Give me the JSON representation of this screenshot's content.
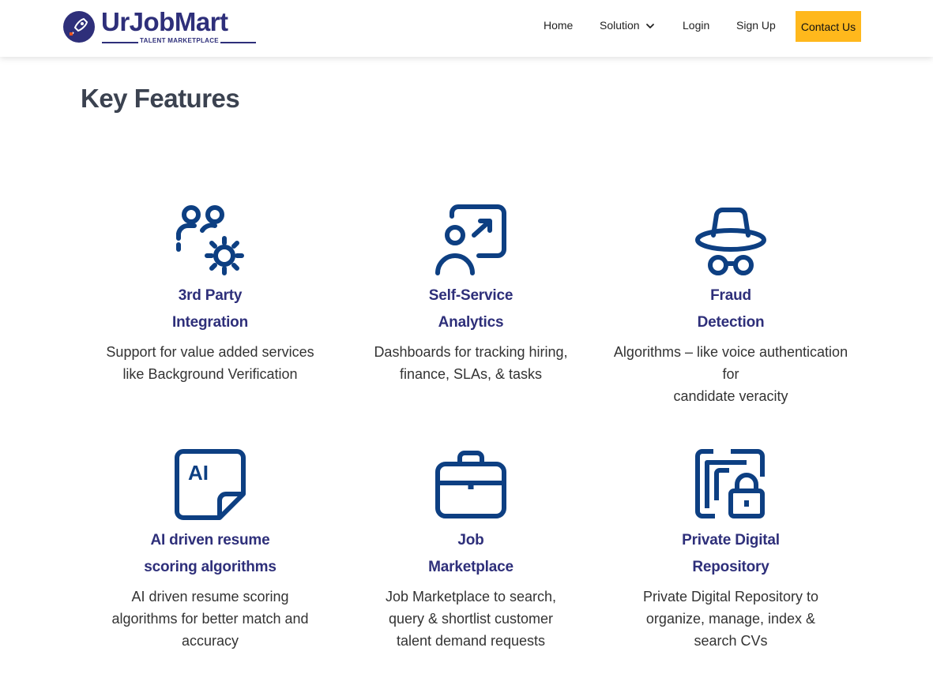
{
  "header": {
    "brand": "UrJobMart",
    "tagline": "TALENT MARKETPLACE",
    "nav": {
      "home": "Home",
      "solution": "Solution",
      "login": "Login",
      "signup": "Sign Up",
      "contact": "Contact Us"
    }
  },
  "page": {
    "title": "Key Features"
  },
  "features": [
    {
      "icon": "people-gear-icon",
      "title_lines": [
        "3rd Party",
        "Integration"
      ],
      "desc_lines": [
        "Support for value added services",
        "like Background Verification"
      ]
    },
    {
      "icon": "analytics-user-icon",
      "title_lines": [
        "Self-Service",
        "Analytics"
      ],
      "desc_lines": [
        "Dashboards for tracking hiring,",
        "finance, SLAs, & tasks"
      ]
    },
    {
      "icon": "incognito-icon",
      "title_lines": [
        "Fraud",
        "Detection"
      ],
      "desc_lines": [
        "Algorithms – like voice authentication",
        "for",
        "candidate veracity"
      ]
    },
    {
      "icon": "ai-note-icon",
      "title_lines": [
        "AI driven resume",
        "scoring algorithms"
      ],
      "desc_lines": [
        "AI driven resume scoring",
        "algorithms for better match and",
        "accuracy"
      ]
    },
    {
      "icon": "briefcase-icon",
      "title_lines": [
        "Job",
        "Marketplace"
      ],
      "desc_lines": [
        "Job Marketplace to search,",
        "query & shortlist customer",
        "talent demand requests"
      ]
    },
    {
      "icon": "secure-repository-icon",
      "title_lines": [
        "Private Digital",
        "Repository"
      ],
      "desc_lines": [
        "Private Digital Repository to",
        "organize, manage, index &",
        "search CVs"
      ]
    }
  ],
  "colors": {
    "brand": "#2e2f7a",
    "icon": "#0d3f82",
    "accent": "#ffb81c",
    "title_text": "#3b4250"
  }
}
